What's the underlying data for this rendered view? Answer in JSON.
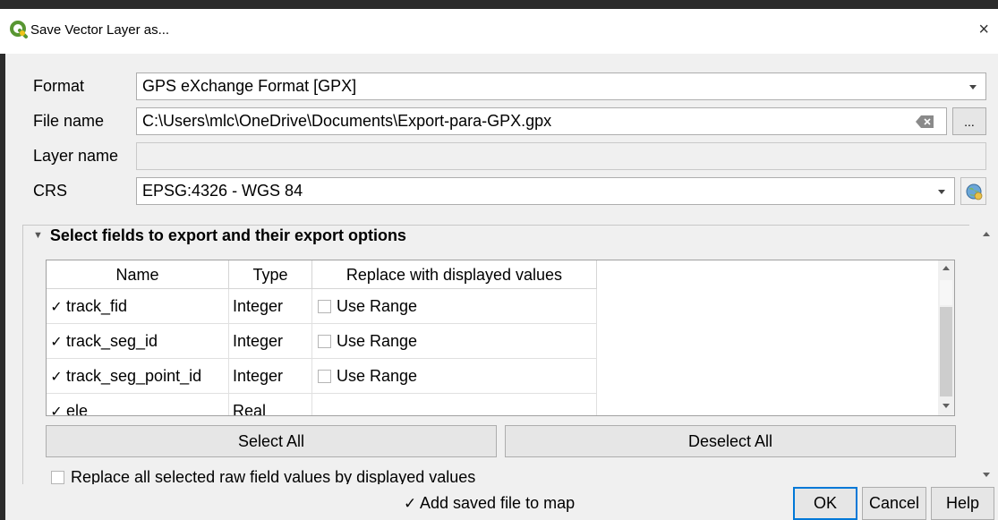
{
  "window": {
    "title": "Save Vector Layer as...",
    "close_symbol": "×"
  },
  "form": {
    "format_label": "Format",
    "format_value": "GPS eXchange Format [GPX]",
    "filename_label": "File name",
    "filename_value": "C:\\Users\\mlc\\OneDrive\\Documents\\Export-para-GPX.gpx",
    "browse_label": "...",
    "layername_label": "Layer name",
    "layername_value": "",
    "crs_label": "CRS",
    "crs_value": "EPSG:4326 - WGS 84"
  },
  "fields_group": {
    "title": "Select fields to export and their export options",
    "headers": [
      "Name",
      "Type",
      "Replace with displayed values"
    ],
    "rows": [
      {
        "checked": true,
        "name": "track_fid",
        "type": "Integer",
        "replace": "Use Range"
      },
      {
        "checked": true,
        "name": "track_seg_id",
        "type": "Integer",
        "replace": "Use Range"
      },
      {
        "checked": true,
        "name": "track_seg_point_id",
        "type": "Integer",
        "replace": "Use Range"
      },
      {
        "checked": true,
        "name": "ele",
        "type": "Real",
        "replace": ""
      }
    ],
    "check_mark": "✓",
    "select_all_label": "Select All",
    "deselect_all_label": "Deselect All",
    "replace_all_label": "Replace all selected raw field values by displayed values"
  },
  "footer": {
    "add_to_map_label": "Add saved file to map",
    "add_to_map_checked": true,
    "ok_label": "OK",
    "cancel_label": "Cancel",
    "help_label": "Help"
  },
  "colors": {
    "accent": "#0078d7",
    "qgis_green": "#589632",
    "qgis_yellow": "#f0c419"
  }
}
